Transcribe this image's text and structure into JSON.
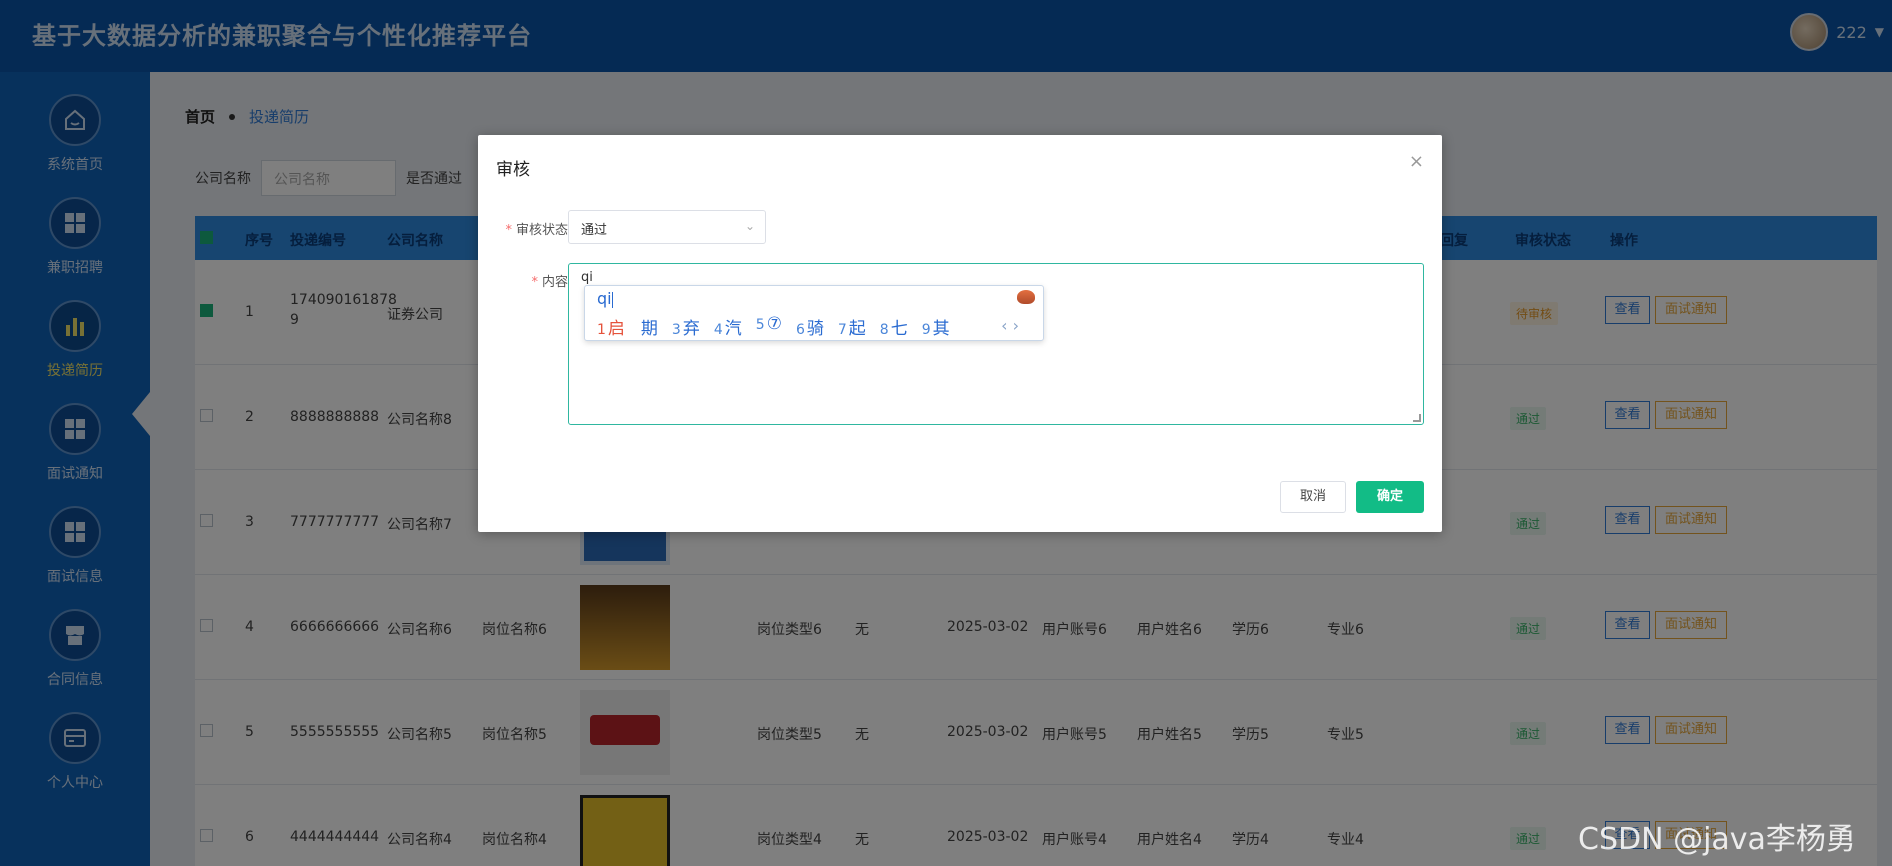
{
  "header": {
    "title": "基于大数据分析的兼职聚合与个性化推荐平台",
    "username": "222"
  },
  "sidebar": {
    "items": [
      {
        "label": "系统首页",
        "icon": "home-icon"
      },
      {
        "label": "兼职招聘",
        "icon": "grid-icon"
      },
      {
        "label": "投递简历",
        "icon": "bar-chart-icon",
        "active": true
      },
      {
        "label": "面试通知",
        "icon": "grid-icon"
      },
      {
        "label": "面试信息",
        "icon": "grid-icon"
      },
      {
        "label": "合同信息",
        "icon": "store-icon"
      },
      {
        "label": "个人中心",
        "icon": "card-icon"
      }
    ]
  },
  "breadcrumb": {
    "home": "首页",
    "current": "投递简历"
  },
  "filter": {
    "company_label": "公司名称",
    "company_placeholder": "公司名称",
    "passed_label": "是否通过"
  },
  "table": {
    "headers": {
      "index": "序号",
      "delivery_no": "投递编号",
      "company": "公司名称",
      "reply": "回复",
      "review_status": "审核状态",
      "actions": "操作"
    },
    "rows": [
      {
        "index": "1",
        "delivery_no": "174090161878\n9",
        "company": "证券公司",
        "position": "",
        "type": "",
        "resume": "",
        "date": "",
        "account": "",
        "name": "",
        "edu": "",
        "major": "",
        "status": "待审核",
        "checked": true
      },
      {
        "index": "2",
        "delivery_no": "8888888888",
        "company": "公司名称8",
        "position": "",
        "type": "",
        "resume": "",
        "date": "",
        "account": "",
        "name": "",
        "edu": "",
        "major": "",
        "status": "通过"
      },
      {
        "index": "3",
        "delivery_no": "7777777777",
        "company": "公司名称7",
        "position": "",
        "type": "",
        "resume": "",
        "date": "",
        "account": "",
        "name": "",
        "edu": "",
        "major": "",
        "status": "通过"
      },
      {
        "index": "4",
        "delivery_no": "6666666666",
        "company": "公司名称6",
        "position": "岗位名称6",
        "type": "岗位类型6",
        "resume": "无",
        "date": "2025-03-02",
        "account": "用户账号6",
        "name": "用户姓名6",
        "edu": "学历6",
        "major": "专业6",
        "status": "通过"
      },
      {
        "index": "5",
        "delivery_no": "5555555555",
        "company": "公司名称5",
        "position": "岗位名称5",
        "type": "岗位类型5",
        "resume": "无",
        "date": "2025-03-02",
        "account": "用户账号5",
        "name": "用户姓名5",
        "edu": "学历5",
        "major": "专业5",
        "status": "通过"
      },
      {
        "index": "6",
        "delivery_no": "4444444444",
        "company": "公司名称4",
        "position": "岗位名称4",
        "type": "岗位类型4",
        "resume": "无",
        "date": "2025-03-02",
        "account": "用户账号4",
        "name": "用户姓名4",
        "edu": "学历4",
        "major": "专业4",
        "status": "通过"
      }
    ],
    "view_label": "查看",
    "notice_label": "面试通知"
  },
  "dialog": {
    "title": "审核",
    "status_label": "审核状态",
    "status_value": "通过",
    "content_label": "内容",
    "content_value": "qi",
    "cancel_label": "取消",
    "ok_label": "确定"
  },
  "ime": {
    "composition": "qi",
    "candidates": [
      {
        "n": "1",
        "text": "启"
      },
      {
        "n": "",
        "text": "期"
      },
      {
        "n": "3",
        "text": "弃"
      },
      {
        "n": "4",
        "text": "汽"
      },
      {
        "n": "5",
        "text": "⑦"
      },
      {
        "n": "6",
        "text": "骑"
      },
      {
        "n": "7",
        "text": "起"
      },
      {
        "n": "8",
        "text": "七"
      },
      {
        "n": "9",
        "text": "其"
      }
    ],
    "nav": "‹  ›"
  },
  "watermark": "CSDN @java李杨勇",
  "colors": {
    "header": "#0a55a8",
    "sidebar": "#0f62b8",
    "primary": "#12bc86",
    "link": "#2f7ad6"
  }
}
